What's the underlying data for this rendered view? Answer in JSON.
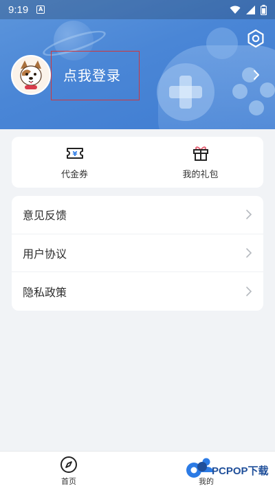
{
  "status_bar": {
    "time": "9:19",
    "indicator": "A"
  },
  "header": {
    "login_text": "点我登录"
  },
  "quick_actions": [
    {
      "label": "代金券",
      "icon": "voucher-icon"
    },
    {
      "label": "我的礼包",
      "icon": "gift-icon"
    }
  ],
  "menu": [
    {
      "label": "意见反馈"
    },
    {
      "label": "用户协议"
    },
    {
      "label": "隐私政策"
    }
  ],
  "bottom_nav": [
    {
      "label": "首页",
      "icon": "compass-icon"
    },
    {
      "label": "我的",
      "icon": "profile-icon"
    }
  ],
  "watermark": {
    "text": "PCPOP下载"
  },
  "colors": {
    "header_blue": "#4a86d6",
    "page_bg": "#f1f3f6",
    "highlight_red": "#d0363b",
    "accent_blue": "#2c7be5"
  }
}
